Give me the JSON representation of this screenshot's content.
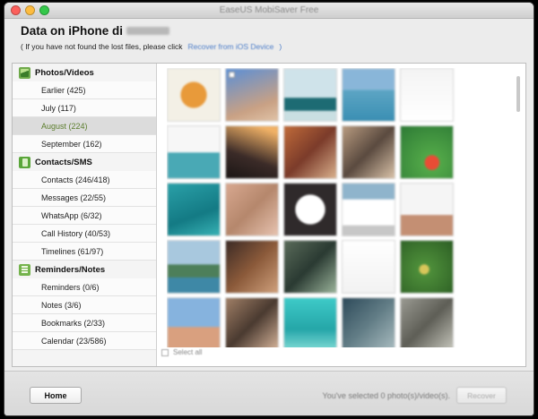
{
  "window": {
    "title": "EaseUS MobiSaver Free"
  },
  "header": {
    "title": "Data on iPhone di",
    "subtitle_prefix": "( If you have not found the lost files, please click",
    "subtitle_link": "Recover from iOS Device",
    "subtitle_suffix": ")"
  },
  "sidebar": {
    "categories": [
      {
        "label": "Photos/Videos",
        "icon": "photos-icon",
        "items": [
          {
            "label": "Earlier (425)",
            "active": false
          },
          {
            "label": "July (117)",
            "active": false
          },
          {
            "label": "August (224)",
            "active": true
          },
          {
            "label": "September (162)",
            "active": false
          }
        ]
      },
      {
        "label": "Contacts/SMS",
        "icon": "contacts-icon",
        "items": [
          {
            "label": "Contacts (246/418)",
            "active": false
          },
          {
            "label": "Messages (22/55)",
            "active": false
          },
          {
            "label": "WhatsApp (6/32)",
            "active": false
          },
          {
            "label": "Call History (40/53)",
            "active": false
          },
          {
            "label": "Timelines (61/97)",
            "active": false
          }
        ]
      },
      {
        "label": "Reminders/Notes",
        "icon": "notes-icon",
        "items": [
          {
            "label": "Reminders (0/6)",
            "active": false
          },
          {
            "label": "Notes (3/6)",
            "active": false
          },
          {
            "label": "Bookmarks (2/33)",
            "active": false
          },
          {
            "label": "Calendar (23/586)",
            "active": false
          }
        ]
      }
    ]
  },
  "grid": {
    "select_all_label": "Select all",
    "thumbnails": [
      "radial-gradient(circle at 50% 50%, #e89a3a 0 35%, #f3f0e6 36%)",
      "linear-gradient(160deg, #5b8fd6, #c9a184 70%, #e0c3a7)",
      "linear-gradient(#cfe3ea 0 55%, #1d6b73 56% 80%, #c9dfe2 81%)",
      "linear-gradient(#89b6d9 0 40%, #5da5c4 41%, #3a8fb3)",
      "linear-gradient(#f4f4f4, #ffffff)",
      "linear-gradient(#f7f7f7 0 50%, #49a9b5 51%)",
      "linear-gradient(200deg, #f0b166 10%, #3b2b28 60%, #1a1514)",
      "linear-gradient(135deg, #c06b3a, #7b3b2a 50%, #d9b08c)",
      "linear-gradient(135deg, #b89b80, #5a4a3f 50%, #d9c2a8)",
      "radial-gradient(circle at 60% 70%, #e94c35 0 15%, #52a848 16%, #2d7a35)",
      "linear-gradient(160deg, #2aa0a8, #137a84 60%, #38b2b5)",
      "linear-gradient(135deg, #d8a890, #b5876c 50%, #e7c3b0)",
      "radial-gradient(circle at 50% 50%, #ffffff 0 40%, #2f2a2b 41%)",
      "linear-gradient(#8fb4cc 0 30%, #ffffff 31% 80%, #c7c7c7 81%)",
      "linear-gradient(#f5f5f5 0 60%, #c48f73 61%)",
      "linear-gradient(#a8c8de 0 45%, #4d7f5a 46% 70%, #3e88a6 71%)",
      "linear-gradient(135deg, #3b2a25, #8b5a3a 50%, #cfa07c)",
      "linear-gradient(135deg, #5a6b5a, #2a3a32 50%, #9ab39a)",
      "linear-gradient(#ffffff, #f2f2f2)",
      "radial-gradient(circle at 45% 55%, #d8c65a 0 12%, #4e8f3a 13%, #2c5e24)",
      "linear-gradient(#86b3de 0 55%, #d9a07f 56%)",
      "linear-gradient(135deg, #a07f66, #4a3a30 50%, #d6b49a)",
      "linear-gradient(#3ecac8, #25a6a8 60%, #7fdad6)",
      "linear-gradient(135deg, #2d4a5a, #627d86 50%, #a9bcc0)",
      "linear-gradient(135deg, #9a9a92, #5e5e56 50%, #c6c6bc)"
    ]
  },
  "footer": {
    "home_label": "Home",
    "status_text": "You've selected 0 photo(s)/video(s).",
    "recover_label": "Recover"
  }
}
